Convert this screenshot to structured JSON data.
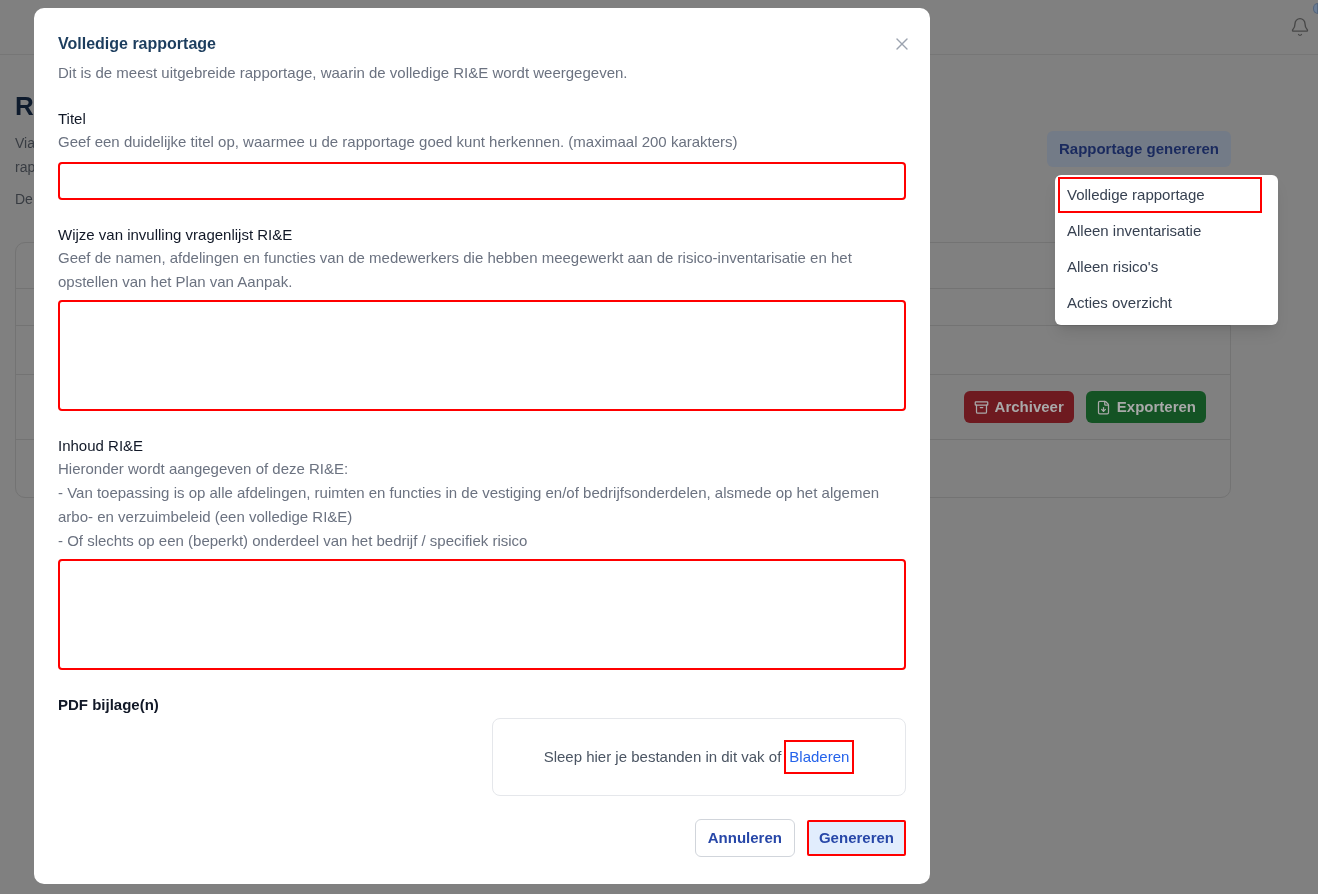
{
  "page": {
    "heading": "R",
    "intro_lines": [
      "Via",
      "rap"
    ],
    "meta": "De",
    "generate_button": "Rapportage genereren",
    "row_actions": [
      {
        "kind": "archive",
        "label": "Archiveer"
      },
      {
        "kind": "export",
        "label": "Exporteren"
      }
    ]
  },
  "report_menu": {
    "items": [
      {
        "label": "Volledige rapportage",
        "highlighted": true
      },
      {
        "label": "Alleen inventarisatie",
        "highlighted": false
      },
      {
        "label": "Alleen risico's",
        "highlighted": false
      },
      {
        "label": "Acties overzicht",
        "highlighted": false
      }
    ]
  },
  "dialog": {
    "title": "Volledige rapportage",
    "description": "Dit is de meest uitgebreide rapportage, waarin de volledige RI&E wordt weergegeven.",
    "fields": [
      {
        "kind": "input",
        "label": "Titel",
        "hint_lines": [
          "Geef een duidelijke titel op, waarmee u de rapportage goed kunt herkennen. (maximaal 200 karakters)"
        ],
        "highlighted": true
      },
      {
        "kind": "textarea",
        "label": "Wijze van invulling vragenlijst RI&E",
        "hint_lines": [
          "Geef de namen, afdelingen en functies van de medewerkers die hebben meegewerkt aan de risico-inventarisatie en het opstellen van het Plan van Aanpak."
        ],
        "highlighted": true
      },
      {
        "kind": "textarea",
        "label": "Inhoud RI&E",
        "hint_lines": [
          "Hieronder wordt aangegeven of deze RI&E:",
          "- Van toepassing is op alle afdelingen, ruimten en functies in de vestiging en/of bedrijfsonderdelen, alsmede op het algemen arbo- en verzuimbeleid (een volledige RI&E)",
          "- Of slechts op een (beperkt) onderdeel van het bedrijf / specifiek risico"
        ],
        "highlighted": true
      }
    ],
    "attachments": {
      "label": "PDF bijlage(n)",
      "dropzone_text": "Sleep hier je bestanden in dit vak of",
      "browse_link": {
        "label": "Bladeren",
        "highlighted": true
      }
    },
    "buttons": [
      {
        "kind": "secondary",
        "label": "Annuleren",
        "highlighted": false
      },
      {
        "kind": "primary",
        "label": "Genereren",
        "highlighted": true
      }
    ]
  }
}
